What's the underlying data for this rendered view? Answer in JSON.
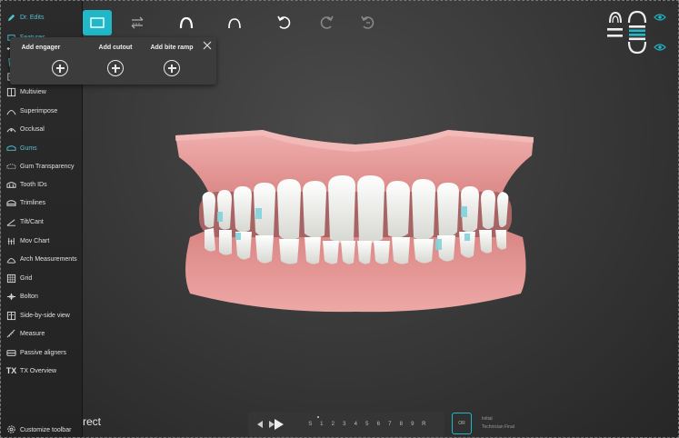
{
  "sidebar": {
    "items": [
      {
        "label": "Dr. Edits",
        "icon": "pencil-icon"
      },
      {
        "label": "Features",
        "icon": "layers-icon"
      },
      {
        "label": "",
        "icon": "move-icon"
      },
      {
        "label": "",
        "icon": "tooth-icon"
      },
      {
        "label": "",
        "icon": "tooth-pair-icon"
      },
      {
        "label": "Multiview",
        "icon": "multiview-icon"
      },
      {
        "label": "Superimpose",
        "icon": "superimpose-icon"
      },
      {
        "label": "Occlusal",
        "icon": "occlusal-icon"
      },
      {
        "label": "Gums",
        "icon": "gums-icon"
      },
      {
        "label": "Gum Transparency",
        "icon": "gum-transparency-icon"
      },
      {
        "label": "Tooth IDs",
        "icon": "tooth-ids-icon"
      },
      {
        "label": "Trimlines",
        "icon": "trimlines-icon"
      },
      {
        "label": "Tilt/Cant",
        "icon": "tilt-icon"
      },
      {
        "label": "Mov Chart",
        "icon": "chart-icon"
      },
      {
        "label": "Arch Measurements",
        "icon": "arch-icon"
      },
      {
        "label": "Grid",
        "icon": "grid-icon"
      },
      {
        "label": "Bolton",
        "icon": "bolton-icon"
      },
      {
        "label": "Side-by-side view",
        "icon": "side-by-side-icon"
      },
      {
        "label": "Measure",
        "icon": "ruler-icon"
      },
      {
        "label": "Passive aligners",
        "icon": "aligner-icon"
      },
      {
        "label": "TX Overview",
        "icon": "tx-icon"
      }
    ],
    "customize_label": "Customize toolbar"
  },
  "popup": {
    "add_engager": "Add engager",
    "add_cutout": "Add cutout",
    "add_bite_ramp": "Add bite ramp"
  },
  "bottom": {
    "title_fragment": "rect",
    "steps": [
      "S",
      "1",
      "2",
      "3",
      "4",
      "5",
      "6",
      "7",
      "8",
      "9",
      "R"
    ],
    "stage_box_label": "OR",
    "stage_line1": "Initial",
    "stage_line2": "Technician Final"
  },
  "colors": {
    "accent": "#20b7c8",
    "gum": "#e7a2a2",
    "tooth": "#f2f2ee"
  }
}
